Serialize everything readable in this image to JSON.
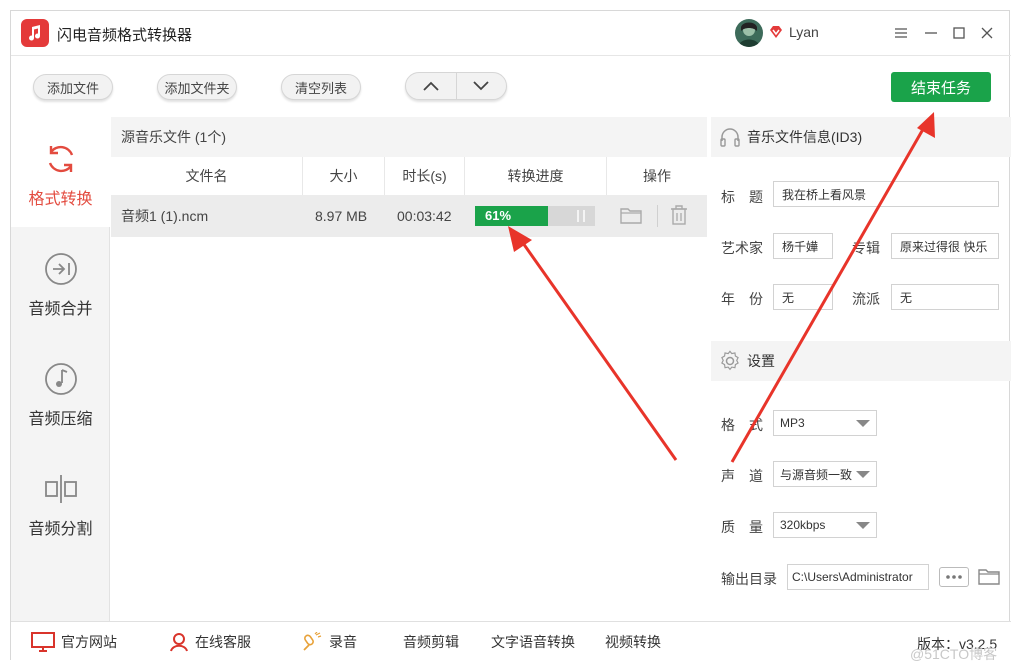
{
  "app": {
    "title": "闪电音频格式转换器"
  },
  "user": {
    "name": "Lyan"
  },
  "toolbar": {
    "add_file": "添加文件",
    "add_folder": "添加文件夹",
    "clear_list": "清空列表",
    "end_task": "结束任务"
  },
  "nav": [
    {
      "label": "格式转换",
      "icon": "refresh-icon",
      "active": true
    },
    {
      "label": "音频合并",
      "icon": "merge-icon",
      "active": false
    },
    {
      "label": "音频压缩",
      "icon": "music-note-icon",
      "active": false
    },
    {
      "label": "音频分割",
      "icon": "split-icon",
      "active": false
    }
  ],
  "filelist": {
    "header": "源音乐文件 (1个)",
    "columns": [
      "文件名",
      "大小",
      "时长(s)",
      "转换进度",
      "操作"
    ],
    "rows": [
      {
        "name": "音频1 (1).ncm",
        "size": "8.97 MB",
        "duration": "00:03:42",
        "progress_text": "61%",
        "progress": 0.61
      }
    ]
  },
  "info": {
    "header": "音乐文件信息(ID3)",
    "title_label": "标　题",
    "title_value": "我在桥上看风景",
    "artist_label": "艺术家",
    "artist_value": "杨千嬅",
    "album_label": "专辑",
    "album_value": "原来过得很 快乐",
    "year_label": "年　份",
    "year_value": "无",
    "genre_label": "流派",
    "genre_value": "无"
  },
  "settings": {
    "header": "设置",
    "format_label": "格　式",
    "format_value": "MP3",
    "channel_label": "声　道",
    "channel_value": "与源音频一致",
    "quality_label": "质　量",
    "quality_value": "320kbps",
    "output_label": "输出目录",
    "output_value": "C:\\Users\\Administrator"
  },
  "footer": {
    "website": "官方网站",
    "service": "在线客服",
    "record": "录音",
    "audio_edit": "音频剪辑",
    "tts": "文字语音转换",
    "video": "视频转换",
    "version": "版本：v3.2.5"
  },
  "watermark": "@51CTO博客",
  "colors": {
    "accent_green": "#1aa34a",
    "accent_red": "#e34b3f",
    "arrow_red": "#e8342a"
  }
}
